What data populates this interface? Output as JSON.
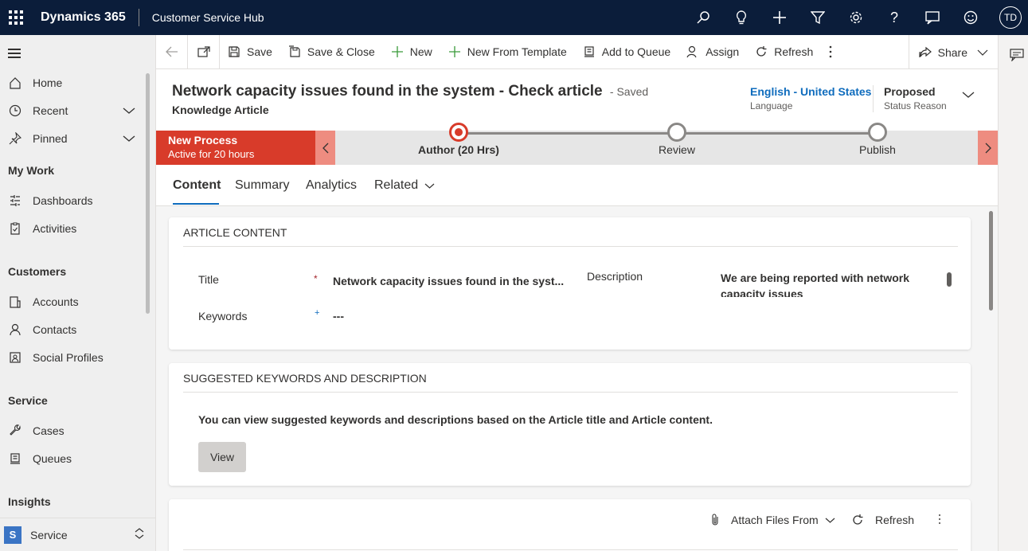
{
  "topbar": {
    "app_name": "Dynamics 365",
    "hub_name": "Customer Service Hub",
    "avatar_initials": "TD"
  },
  "sidebar": {
    "items": [
      {
        "label": "Home",
        "icon": "home-icon"
      },
      {
        "label": "Recent",
        "icon": "clock-icon"
      },
      {
        "label": "Pinned",
        "icon": "pin-icon"
      }
    ],
    "sections": [
      {
        "heading": "My Work",
        "items": [
          {
            "label": "Dashboards",
            "icon": "dashboard-icon"
          },
          {
            "label": "Activities",
            "icon": "clipboard-icon"
          }
        ]
      },
      {
        "heading": "Customers",
        "items": [
          {
            "label": "Accounts",
            "icon": "building-icon"
          },
          {
            "label": "Contacts",
            "icon": "person-icon"
          },
          {
            "label": "Social Profiles",
            "icon": "social-profile-icon"
          }
        ]
      },
      {
        "heading": "Service",
        "items": [
          {
            "label": "Cases",
            "icon": "wrench-icon"
          },
          {
            "label": "Queues",
            "icon": "queue-icon"
          }
        ]
      },
      {
        "heading": "Insights",
        "items": []
      }
    ],
    "area_switcher": {
      "badge": "S",
      "label": "Service"
    }
  },
  "commandbar": {
    "save": "Save",
    "save_close": "Save & Close",
    "new": "New",
    "new_template": "New From Template",
    "add_queue": "Add to Queue",
    "assign": "Assign",
    "refresh": "Refresh",
    "share": "Share"
  },
  "header": {
    "title": "Network capacity issues found in the system - Check article",
    "saved": "- Saved",
    "entity": "Knowledge Article",
    "language_value": "English - United States",
    "language_label": "Language",
    "status_value": "Proposed",
    "status_label": "Status Reason"
  },
  "process": {
    "name": "New Process",
    "duration": "Active for 20 hours",
    "stages": [
      {
        "label": "Author  (20 Hrs)",
        "state": "active"
      },
      {
        "label": "Review",
        "state": "inactive"
      },
      {
        "label": "Publish",
        "state": "inactive"
      }
    ]
  },
  "tabs": [
    "Content",
    "Summary",
    "Analytics",
    "Related"
  ],
  "article_content": {
    "heading": "ARTICLE CONTENT",
    "title_label": "Title",
    "title_value": "Network capacity issues found in the syst...",
    "keywords_label": "Keywords",
    "keywords_value": "---",
    "description_label": "Description",
    "description_value": "We are being reported with network capacity issues"
  },
  "suggested": {
    "heading": "SUGGESTED KEYWORDS AND DESCRIPTION",
    "text": "You can view suggested keywords and descriptions based on the Article title and Article content.",
    "button": "View"
  },
  "attachments": {
    "attach_label": "Attach Files From",
    "refresh_label": "Refresh"
  }
}
